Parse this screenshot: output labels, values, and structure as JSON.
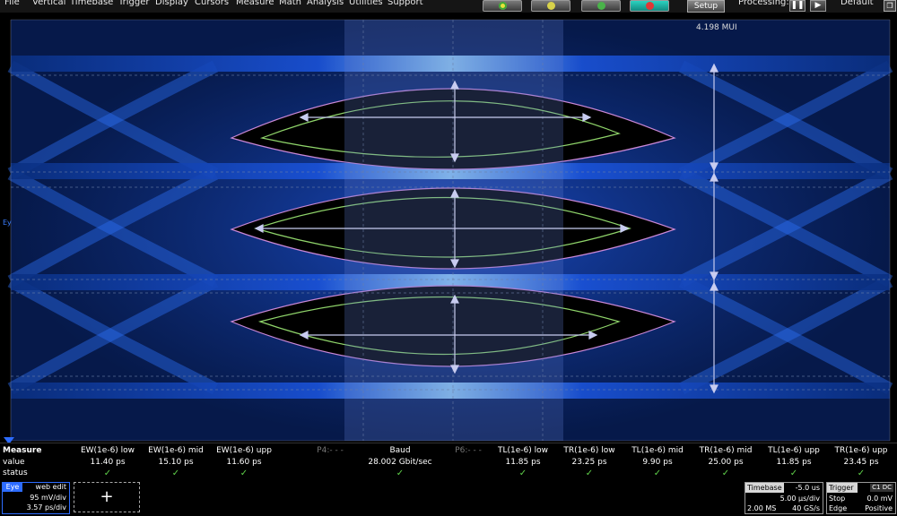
{
  "menu": [
    "File",
    "Vertical",
    "Timebase",
    "Trigger",
    "Display",
    "Cursors",
    "Measure",
    "Math",
    "Analysis",
    "Utilities",
    "Support"
  ],
  "toolbar": {
    "setup_label": "Setup",
    "processing_label": "Processing:",
    "pause_icon": "pause-icon",
    "play_icon": "play-icon",
    "default_label": "Default",
    "restore_icon": "restore-icon"
  },
  "display": {
    "mui_readout": "4.198 MUI",
    "channel_marker": "Ey"
  },
  "measure": {
    "row_labels": {
      "title": "Measure",
      "value": "value",
      "status": "status"
    },
    "params": [
      {
        "name": "EW(1e-6) low",
        "value": "11.40 ps",
        "status": "✓",
        "active": true
      },
      {
        "name": "EW(1e-6) mid",
        "value": "15.10 ps",
        "status": "✓",
        "active": true
      },
      {
        "name": "EW(1e-6) upp",
        "value": "11.60 ps",
        "status": "✓",
        "active": true
      },
      {
        "name": "P4:- - -",
        "value": "",
        "status": "",
        "active": false
      },
      {
        "name": "Baud",
        "value": "28.002 Gbit/sec",
        "status": "✓",
        "active": true
      },
      {
        "name": "P6:- - -",
        "value": "",
        "status": "",
        "active": false
      },
      {
        "name": "TL(1e-6) low",
        "value": "11.85 ps",
        "status": "✓",
        "active": true
      },
      {
        "name": "TR(1e-6) low",
        "value": "23.25 ps",
        "status": "✓",
        "active": true
      },
      {
        "name": "TL(1e-6) mid",
        "value": "9.90 ps",
        "status": "✓",
        "active": true
      },
      {
        "name": "TR(1e-6) mid",
        "value": "25.00 ps",
        "status": "✓",
        "active": true
      },
      {
        "name": "TL(1e-6) upp",
        "value": "11.85 ps",
        "status": "✓",
        "active": true
      },
      {
        "name": "TR(1e-6) upp",
        "value": "23.45 ps",
        "status": "✓",
        "active": true
      }
    ]
  },
  "channel": {
    "tag": "Eye",
    "desc": "web edit",
    "scale": "95 mV/div",
    "time": "3.57 ps/div"
  },
  "add_label": "+",
  "timebase": {
    "title": "Timebase",
    "delay": "-5.0 us",
    "div": "5.00 µs/div",
    "samples": "2.00 MS",
    "rate": "40 GS/s"
  },
  "trigger": {
    "title": "Trigger",
    "tag": "C1 DC",
    "mode": "Stop",
    "level": "0.0 mV",
    "type": "Edge",
    "slope": "Positive"
  },
  "colors": {
    "accent": "#2d6cff",
    "ok": "#5fd14a",
    "eye_green": "#8fd46a",
    "eye_pink": "#c987d6"
  }
}
